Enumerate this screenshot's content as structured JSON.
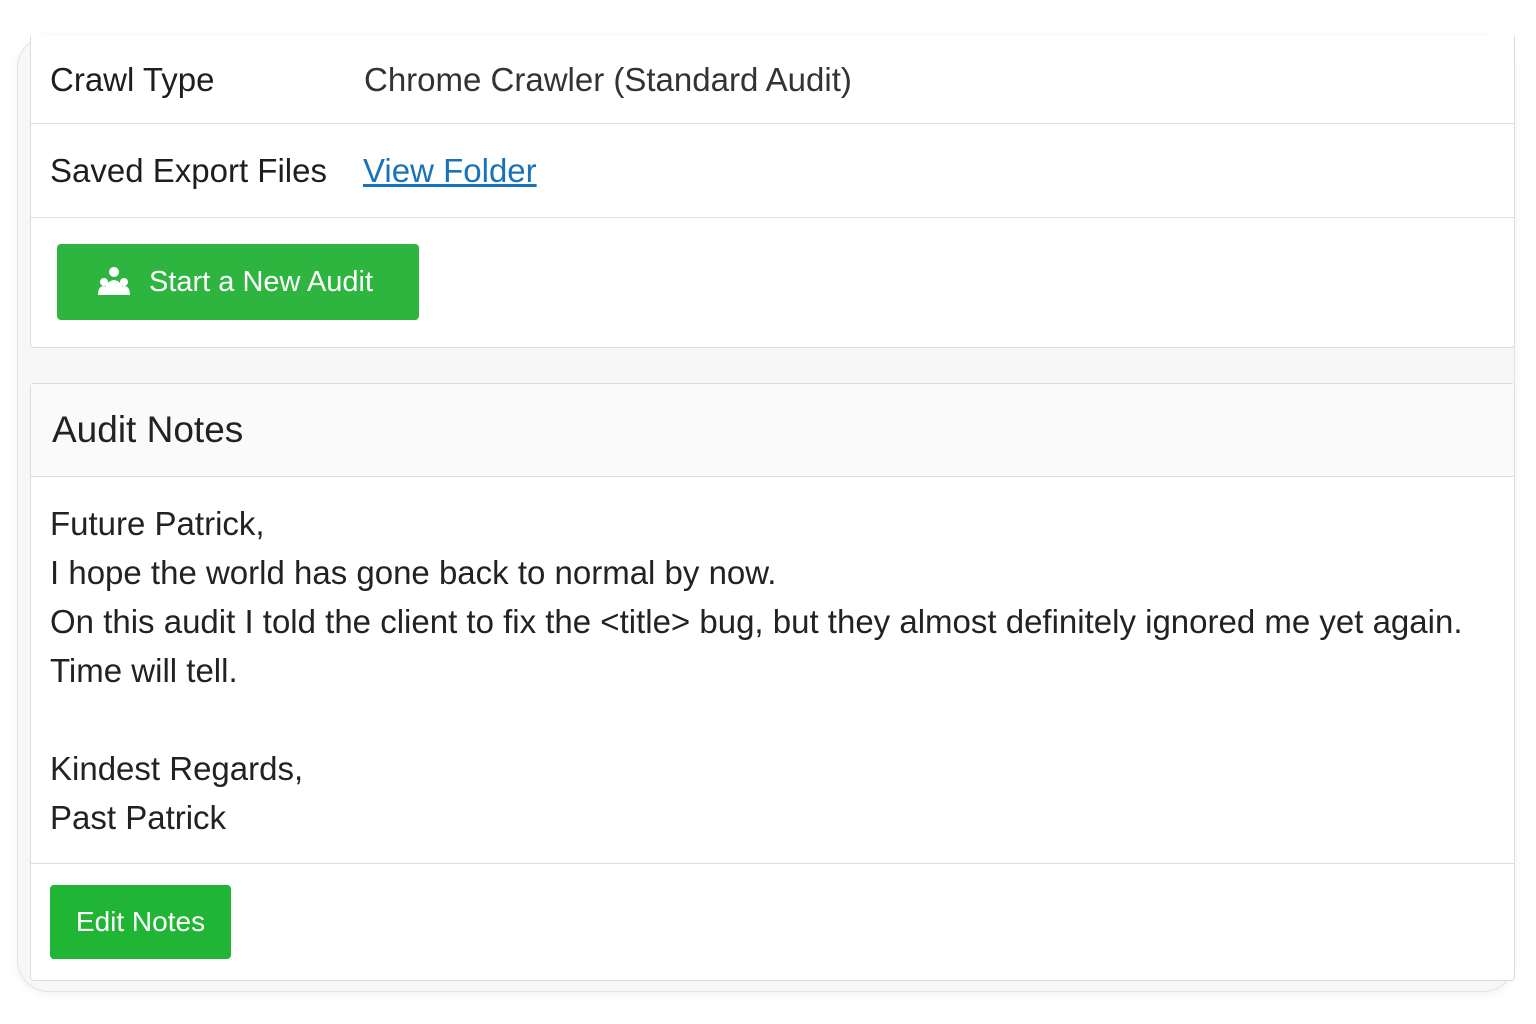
{
  "details": {
    "crawl_type_label": "Crawl Type",
    "crawl_type_value": "Chrome Crawler (Standard Audit)",
    "saved_export_label": "Saved Export Files",
    "view_folder_link": "View Folder"
  },
  "actions": {
    "start_audit_label": "Start a New Audit",
    "start_audit_icon": "users-group-icon"
  },
  "notes": {
    "title": "Audit Notes",
    "lines": [
      "Future Patrick,",
      "I hope the world has gone back to normal by now.",
      "On this audit I told the client to fix the <title> bug, but they almost definitely ignored me yet again.",
      "Time will tell.",
      "",
      "Kindest Regards,",
      "Past Patrick"
    ],
    "edit_label": "Edit Notes"
  },
  "colors": {
    "primary_button": "#2eb540",
    "link": "#1a73b8"
  }
}
